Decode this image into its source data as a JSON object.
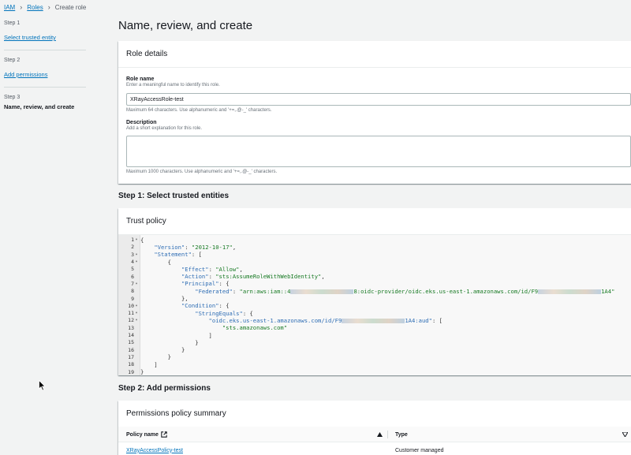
{
  "breadcrumb": {
    "items": [
      {
        "label": "IAM",
        "link": true
      },
      {
        "label": "Roles",
        "link": true
      },
      {
        "label": "Create role",
        "link": false
      }
    ]
  },
  "steps": [
    {
      "number": "Step 1",
      "label": "Select trusted entity",
      "current": false
    },
    {
      "number": "Step 2",
      "label": "Add permissions",
      "current": false
    },
    {
      "number": "Step 3",
      "label": "Name, review, and create",
      "current": true
    }
  ],
  "page": {
    "title": "Name, review, and create"
  },
  "role_details": {
    "header": "Role details",
    "role_name_label": "Role name",
    "role_name_hint": "Enter a meaningful name to identify this role.",
    "role_name_value": "XRayAccessRole-test",
    "role_name_constraint": "Maximum 64 characters. Use alphanumeric and '+=,.@-_' characters.",
    "description_label": "Description",
    "description_hint": "Add a short explanation for this role.",
    "description_value": "",
    "description_constraint": "Maximum 1000 characters. Use alphanumeric and '+=,.@-_' characters."
  },
  "step1": {
    "title": "Step 1: Select trusted entities",
    "trust_policy_header": "Trust policy",
    "code_lines": [
      {
        "n": "1",
        "fold": true,
        "indent": 0,
        "parts": [
          [
            "p",
            "{"
          ]
        ]
      },
      {
        "n": "2",
        "fold": false,
        "indent": 1,
        "parts": [
          [
            "k",
            "\"Version\""
          ],
          [
            "p",
            ": "
          ],
          [
            "s",
            "\"2012-10-17\""
          ],
          [
            "p",
            ","
          ]
        ]
      },
      {
        "n": "3",
        "fold": true,
        "indent": 1,
        "parts": [
          [
            "k",
            "\"Statement\""
          ],
          [
            "p",
            ": ["
          ]
        ]
      },
      {
        "n": "4",
        "fold": true,
        "indent": 2,
        "parts": [
          [
            "p",
            "{"
          ]
        ]
      },
      {
        "n": "5",
        "fold": false,
        "indent": 3,
        "parts": [
          [
            "k",
            "\"Effect\""
          ],
          [
            "p",
            ": "
          ],
          [
            "s",
            "\"Allow\""
          ],
          [
            "p",
            ","
          ]
        ]
      },
      {
        "n": "6",
        "fold": false,
        "indent": 3,
        "parts": [
          [
            "k",
            "\"Action\""
          ],
          [
            "p",
            ": "
          ],
          [
            "s",
            "\"sts:AssumeRoleWithWebIdentity\""
          ],
          [
            "p",
            ","
          ]
        ]
      },
      {
        "n": "7",
        "fold": true,
        "indent": 3,
        "parts": [
          [
            "k",
            "\"Principal\""
          ],
          [
            "p",
            ": {"
          ]
        ]
      },
      {
        "n": "8",
        "fold": false,
        "indent": 4,
        "parts": [
          [
            "k",
            "\"Federated\""
          ],
          [
            "p",
            ": "
          ],
          [
            "s",
            "\"arn:aws:iam::4"
          ],
          [
            "blur",
            ""
          ],
          [
            "s",
            "8:oidc-provider/oidc.eks.us-east-1.amazonaws.com/id/F9"
          ],
          [
            "blur",
            ""
          ],
          [
            "s",
            "1A4\""
          ]
        ]
      },
      {
        "n": "9",
        "fold": false,
        "indent": 3,
        "parts": [
          [
            "p",
            "},"
          ]
        ]
      },
      {
        "n": "10",
        "fold": true,
        "indent": 3,
        "parts": [
          [
            "k",
            "\"Condition\""
          ],
          [
            "p",
            ": {"
          ]
        ]
      },
      {
        "n": "11",
        "fold": true,
        "indent": 4,
        "parts": [
          [
            "k",
            "\"StringEquals\""
          ],
          [
            "p",
            ": {"
          ]
        ]
      },
      {
        "n": "12",
        "fold": true,
        "indent": 5,
        "parts": [
          [
            "k",
            "\"oidc.eks.us-east-1.amazonaws.com/id/F9"
          ],
          [
            "blur",
            ""
          ],
          [
            "k",
            "1A4:aud\""
          ],
          [
            "p",
            ": ["
          ]
        ]
      },
      {
        "n": "13",
        "fold": false,
        "indent": 6,
        "parts": [
          [
            "s",
            "\"sts.amazonaws.com\""
          ]
        ]
      },
      {
        "n": "14",
        "fold": false,
        "indent": 5,
        "parts": [
          [
            "p",
            "]"
          ]
        ]
      },
      {
        "n": "15",
        "fold": false,
        "indent": 4,
        "parts": [
          [
            "p",
            "}"
          ]
        ]
      },
      {
        "n": "16",
        "fold": false,
        "indent": 3,
        "parts": [
          [
            "p",
            "}"
          ]
        ]
      },
      {
        "n": "17",
        "fold": false,
        "indent": 2,
        "parts": [
          [
            "p",
            "}"
          ]
        ]
      },
      {
        "n": "18",
        "fold": false,
        "indent": 1,
        "parts": [
          [
            "p",
            "]"
          ]
        ]
      },
      {
        "n": "19",
        "fold": false,
        "indent": 0,
        "parts": [
          [
            "p",
            "}"
          ]
        ]
      }
    ]
  },
  "step2": {
    "title": "Step 2: Add permissions",
    "summary_header": "Permissions policy summary",
    "columns": [
      {
        "label": "Policy name",
        "icon": "external-link-icon",
        "sort": "sort-up-icon"
      },
      {
        "label": "Type",
        "sort": "sort-down-icon"
      }
    ],
    "rows": [
      {
        "policy_name": "XRayAccessPolicy-test",
        "type": "Customer managed"
      }
    ]
  },
  "colors": {
    "link": "#0073bb",
    "background": "#f2f3f3",
    "card": "#ffffff",
    "json_key": "#2e6db4",
    "json_string": "#187a24"
  }
}
